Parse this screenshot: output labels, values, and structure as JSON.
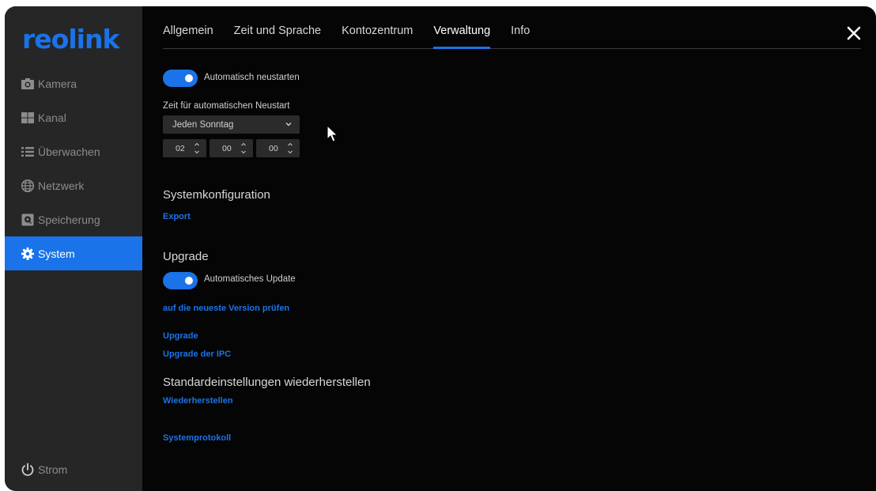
{
  "app": {
    "logo": "reolink"
  },
  "sidebar": {
    "items": [
      {
        "label": "Kamera",
        "icon": "camera-icon"
      },
      {
        "label": "Kanal",
        "icon": "grid-icon"
      },
      {
        "label": "Überwachen",
        "icon": "list-icon"
      },
      {
        "label": "Netzwerk",
        "icon": "globe-icon"
      },
      {
        "label": "Speicherung",
        "icon": "storage-icon"
      },
      {
        "label": "System",
        "icon": "gear-icon",
        "active": true
      }
    ],
    "power": {
      "label": "Strom",
      "icon": "power-icon"
    }
  },
  "tabs": [
    {
      "label": "Allgemein"
    },
    {
      "label": "Zeit und Sprache"
    },
    {
      "label": "Kontozentrum"
    },
    {
      "label": "Verwaltung",
      "active": true
    },
    {
      "label": "Info"
    }
  ],
  "auto_restart": {
    "toggle_label": "Automatisch neustarten",
    "enabled": true,
    "time_label": "Zeit für automatischen Neustart",
    "schedule": "Jeden Sonntag",
    "hour": "02",
    "minute": "00",
    "second": "00"
  },
  "config": {
    "title": "Systemkonfiguration",
    "export": "Export"
  },
  "upgrade": {
    "title": "Upgrade",
    "toggle_label": "Automatisches Update",
    "enabled": true,
    "check_link": "auf die neueste Version prüfen",
    "upgrade_link": "Upgrade",
    "ipc_link": "Upgrade der IPC"
  },
  "reset": {
    "title": "Standardeinstellungen wiederherstellen",
    "restore": "Wiederherstellen"
  },
  "log": {
    "link": "Systemprotokoll"
  },
  "colors": {
    "accent": "#1a73e8",
    "sidebar_bg": "#262626",
    "content_bg": "#050505"
  }
}
